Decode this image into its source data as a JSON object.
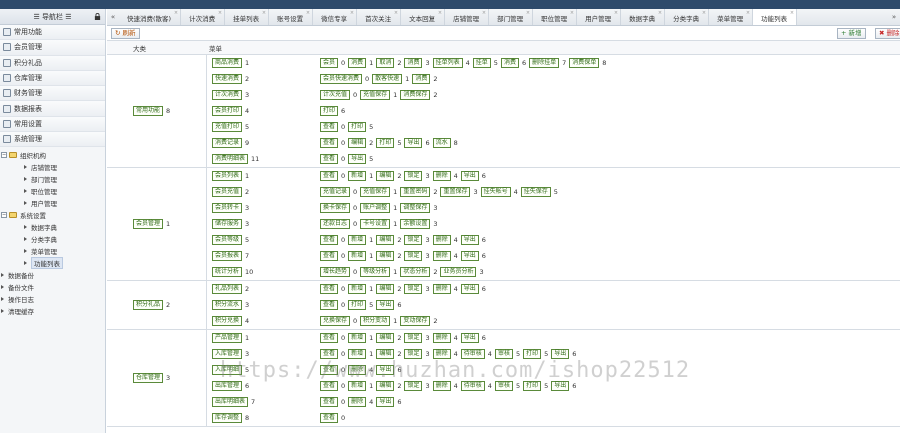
{
  "sidebar": {
    "title": "导航栏",
    "menu": [
      "常用功能",
      "会员管理",
      "积分礼品",
      "仓库管理",
      "财务管理",
      "数据报表",
      "常用设置",
      "系统管理"
    ],
    "tree": [
      {
        "label": "组织机构",
        "level": 0,
        "type": "folder"
      },
      {
        "label": "店铺管理",
        "level": 1,
        "type": "leaf"
      },
      {
        "label": "部门管理",
        "level": 1,
        "type": "leaf"
      },
      {
        "label": "职位管理",
        "level": 1,
        "type": "leaf"
      },
      {
        "label": "用户管理",
        "level": 1,
        "type": "leaf"
      },
      {
        "label": "系统设置",
        "level": 0,
        "type": "folder"
      },
      {
        "label": "数据字典",
        "level": 1,
        "type": "leaf"
      },
      {
        "label": "分类字典",
        "level": 1,
        "type": "leaf"
      },
      {
        "label": "菜单管理",
        "level": 1,
        "type": "leaf"
      },
      {
        "label": "功能列表",
        "level": 1,
        "type": "leaf",
        "selected": true
      },
      {
        "label": "数据备份",
        "level": 0,
        "type": "leaf"
      },
      {
        "label": "备份文件",
        "level": 0,
        "type": "leaf"
      },
      {
        "label": "操作日志",
        "level": 0,
        "type": "leaf"
      },
      {
        "label": "清理缓存",
        "level": 0,
        "type": "leaf"
      }
    ]
  },
  "tabs": [
    "快速消费(散客)",
    "计次消费",
    "挂单列表",
    "账号设置",
    "微信专享",
    "首次关注",
    "文本回复",
    "店铺管理",
    "部门管理",
    "职位管理",
    "用户管理",
    "数据字典",
    "分类字典",
    "菜单管理",
    "功能列表"
  ],
  "tab_nav": {
    "prev": "«",
    "next": "»"
  },
  "toolbar": {
    "refresh": "刷新",
    "add": "新增",
    "delete": "删除"
  },
  "grid": {
    "col_group": "大类",
    "col_menu": "菜单"
  },
  "groups": [
    {
      "name": "常用功能",
      "count": "8",
      "rows": [
        {
          "menu": "商品消费",
          "n": "1",
          "ops": [
            [
              "会员",
              "0"
            ],
            [
              "消费",
              "1"
            ],
            [
              "取消",
              "2"
            ],
            [
              "消费",
              "3"
            ],
            [
              "挂单列表",
              "4"
            ],
            [
              "挂单",
              "5"
            ],
            [
              "消费",
              "6"
            ],
            [
              "删除挂单",
              "7"
            ],
            [
              "消费保单",
              "8"
            ]
          ]
        },
        {
          "menu": "快速消费",
          "n": "2",
          "ops": [
            [
              "会员快速消费",
              "0"
            ],
            [
              "散客快速",
              "1"
            ],
            [
              "消费",
              "2"
            ]
          ]
        },
        {
          "menu": "计次消费",
          "n": "3",
          "ops": [
            [
              "计次充值",
              "0"
            ],
            [
              "充值保存",
              "1"
            ],
            [
              "消费保存",
              "2"
            ]
          ]
        },
        {
          "menu": "会员打印",
          "n": "4",
          "ops": [
            [
              "打印",
              "6"
            ]
          ]
        },
        {
          "menu": "充值打印",
          "n": "5",
          "ops": [
            [
              "查看",
              "0"
            ],
            [
              "打印",
              "5"
            ]
          ]
        },
        {
          "menu": "消费记录",
          "n": "9",
          "ops": [
            [
              "查看",
              "0"
            ],
            [
              "编辑",
              "2"
            ],
            [
              "打印",
              "5"
            ],
            [
              "导出",
              "6"
            ],
            [
              "流水",
              "8"
            ]
          ]
        },
        {
          "menu": "消费明细表",
          "n": "11",
          "ops": [
            [
              "查看",
              "0"
            ],
            [
              "导出",
              "5"
            ]
          ]
        }
      ]
    },
    {
      "name": "会员管理",
      "count": "1",
      "rows": [
        {
          "menu": "会员列表",
          "n": "1",
          "ops": [
            [
              "查看",
              "0"
            ],
            [
              "新增",
              "1"
            ],
            [
              "编辑",
              "2"
            ],
            [
              "锁定",
              "3"
            ],
            [
              "删除",
              "4"
            ],
            [
              "导出",
              "6"
            ]
          ]
        },
        {
          "menu": "会员充值",
          "n": "2",
          "ops": [
            [
              "充值记录",
              "0"
            ],
            [
              "充值保存",
              "1"
            ],
            [
              "重置密码",
              "2"
            ],
            [
              "重置保存",
              "3"
            ],
            [
              "挂失帐号",
              "4"
            ],
            [
              "挂失保存",
              "5"
            ]
          ]
        },
        {
          "menu": "会员转卡",
          "n": "3",
          "ops": [
            [
              "换卡保存",
              "0"
            ],
            [
              "账户调整",
              "1"
            ],
            [
              "调整保存",
              "3"
            ]
          ]
        },
        {
          "menu": "储存服务",
          "n": "3",
          "ops": [
            [
              "还款日志",
              "0"
            ],
            [
              "卡号设置",
              "1"
            ],
            [
              "余额设置",
              "3"
            ]
          ]
        },
        {
          "menu": "会员等级",
          "n": "5",
          "ops": [
            [
              "查看",
              "0"
            ],
            [
              "新增",
              "1"
            ],
            [
              "编辑",
              "2"
            ],
            [
              "锁定",
              "3"
            ],
            [
              "删除",
              "4"
            ],
            [
              "导出",
              "6"
            ]
          ]
        },
        {
          "menu": "会员报表",
          "n": "7",
          "ops": [
            [
              "查看",
              "0"
            ],
            [
              "新增",
              "1"
            ],
            [
              "编辑",
              "2"
            ],
            [
              "锁定",
              "3"
            ],
            [
              "删除",
              "4"
            ],
            [
              "导出",
              "6"
            ]
          ]
        },
        {
          "menu": "统计分析",
          "n": "10",
          "ops": [
            [
              "增长趋势",
              "0"
            ],
            [
              "等级分析",
              "1"
            ],
            [
              "状态分析",
              "2"
            ],
            [
              "业务员分析",
              "3"
            ]
          ]
        }
      ]
    },
    {
      "name": "积分礼品",
      "count": "2",
      "rows": [
        {
          "menu": "礼品列表",
          "n": "2",
          "ops": [
            [
              "查看",
              "0"
            ],
            [
              "新增",
              "1"
            ],
            [
              "编辑",
              "2"
            ],
            [
              "锁定",
              "3"
            ],
            [
              "删除",
              "4"
            ],
            [
              "导出",
              "6"
            ]
          ]
        },
        {
          "menu": "积分流水",
          "n": "3",
          "ops": [
            [
              "查看",
              "0"
            ],
            [
              "打印",
              "5"
            ],
            [
              "导出",
              "6"
            ]
          ]
        },
        {
          "menu": "积分兑换",
          "n": "4",
          "ops": [
            [
              "兑换保存",
              "0"
            ],
            [
              "积分变动",
              "1"
            ],
            [
              "变动保存",
              "2"
            ]
          ]
        }
      ]
    },
    {
      "name": "仓库管理",
      "count": "3",
      "rows": [
        {
          "menu": "产品管理",
          "n": "1",
          "ops": [
            [
              "查看",
              "0"
            ],
            [
              "新增",
              "1"
            ],
            [
              "编辑",
              "2"
            ],
            [
              "锁定",
              "3"
            ],
            [
              "删除",
              "4"
            ],
            [
              "导出",
              "6"
            ]
          ]
        },
        {
          "menu": "入库管理",
          "n": "3",
          "ops": [
            [
              "查看",
              "0"
            ],
            [
              "新增",
              "1"
            ],
            [
              "编辑",
              "2"
            ],
            [
              "锁定",
              "3"
            ],
            [
              "删除",
              "4"
            ],
            [
              "待审核",
              "4"
            ],
            [
              "审核",
              "5"
            ],
            [
              "打印",
              "5"
            ],
            [
              "导出",
              "6"
            ]
          ]
        },
        {
          "menu": "入库明细",
          "n": "5",
          "ops": [
            [
              "查看",
              "0"
            ],
            [
              "删除",
              "4"
            ],
            [
              "导出",
              "6"
            ]
          ]
        },
        {
          "menu": "出库管理",
          "n": "6",
          "ops": [
            [
              "查看",
              "0"
            ],
            [
              "新增",
              "1"
            ],
            [
              "编辑",
              "2"
            ],
            [
              "锁定",
              "3"
            ],
            [
              "删除",
              "4"
            ],
            [
              "待审核",
              "4"
            ],
            [
              "审核",
              "5"
            ],
            [
              "打印",
              "5"
            ],
            [
              "导出",
              "6"
            ]
          ]
        },
        {
          "menu": "出库明细表",
          "n": "7",
          "ops": [
            [
              "查看",
              "0"
            ],
            [
              "删除",
              "4"
            ],
            [
              "导出",
              "6"
            ]
          ]
        },
        {
          "menu": "库存调整",
          "n": "8",
          "ops": [
            [
              "查看",
              "0"
            ]
          ]
        }
      ]
    }
  ],
  "watermark": "https://www.huzhan.com/ishop22512"
}
